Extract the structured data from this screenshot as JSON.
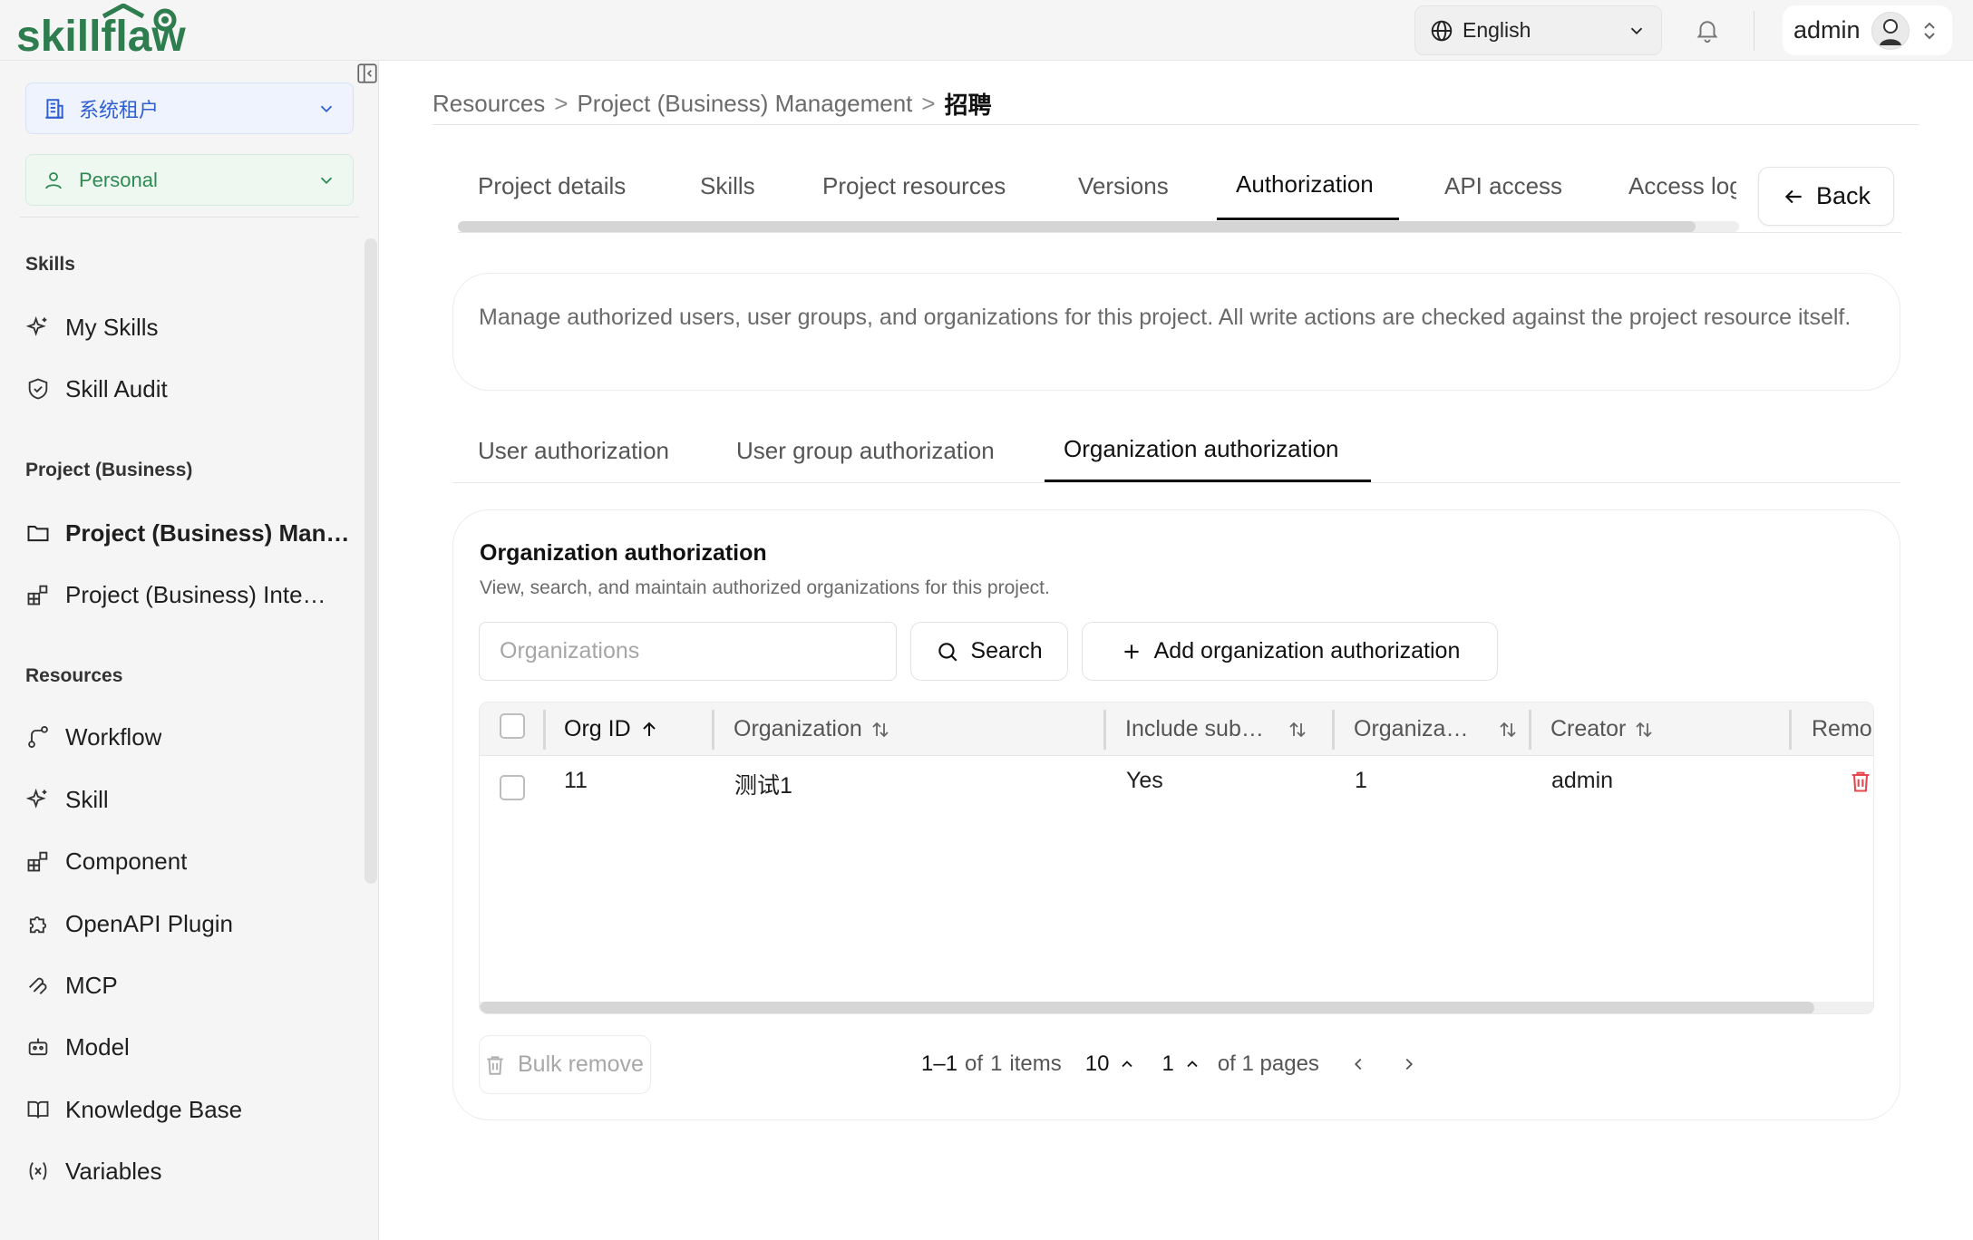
{
  "brand": {
    "name": "skillflaw",
    "color": "#2e7d4f"
  },
  "header": {
    "language": "English",
    "user": "admin"
  },
  "sidebar": {
    "tenant": "系统租户",
    "space": "Personal",
    "sections": [
      {
        "title": "Skills",
        "items": [
          {
            "label": "My Skills",
            "icon": "sparkle-icon"
          },
          {
            "label": "Skill Audit",
            "icon": "shield-check-icon"
          }
        ]
      },
      {
        "title": "Project (Business)",
        "items": [
          {
            "label": "Project (Business) Man…",
            "icon": "folder-icon",
            "active": true
          },
          {
            "label": "Project (Business) Inte…",
            "icon": "blocks-icon"
          }
        ]
      },
      {
        "title": "Resources",
        "items": [
          {
            "label": "Workflow",
            "icon": "workflow-icon"
          },
          {
            "label": "Skill",
            "icon": "sparkle-icon"
          },
          {
            "label": "Component",
            "icon": "blocks-icon"
          },
          {
            "label": "OpenAPI Plugin",
            "icon": "puzzle-icon"
          },
          {
            "label": "MCP",
            "icon": "mcp-icon"
          },
          {
            "label": "Model",
            "icon": "robot-icon"
          },
          {
            "label": "Knowledge Base",
            "icon": "book-icon"
          },
          {
            "label": "Variables",
            "icon": "variable-icon"
          }
        ]
      }
    ]
  },
  "breadcrumb": {
    "items": [
      "Resources",
      "Project (Business) Management",
      "招聘"
    ],
    "separator": ">"
  },
  "tabs": [
    "Project details",
    "Skills",
    "Project resources",
    "Versions",
    "Authorization",
    "API access",
    "Access log"
  ],
  "back_label": "Back",
  "description": "Manage authorized users, user groups, and organizations for this project. All write actions are checked against the project resource itself.",
  "subtabs": [
    "User authorization",
    "User group authorization",
    "Organization authorization"
  ],
  "card": {
    "title": "Organization authorization",
    "subtitle": "View, search, and maintain authorized organizations for this project.",
    "search_placeholder": "Organizations",
    "search_label": "Search",
    "add_label": "Add organization authorization"
  },
  "table": {
    "columns": [
      "Org ID",
      "Organization",
      "Include sub…",
      "Organiza…",
      "Creator",
      "Remo"
    ],
    "rows": [
      {
        "org_id": "11",
        "organization": "测试1",
        "include_sub": "Yes",
        "org_count": "1",
        "creator": "admin"
      }
    ]
  },
  "footer": {
    "bulk_remove": "Bulk remove",
    "range": "1–1",
    "of_items_prefix": "of",
    "items_total": "1",
    "items_suffix": "items",
    "page_size": "10",
    "page": "1",
    "of_pages": "of 1 pages"
  },
  "colors": {
    "accent_blue": "#2f5fd0",
    "accent_green": "#2e8a52",
    "danger": "#e5484d"
  }
}
